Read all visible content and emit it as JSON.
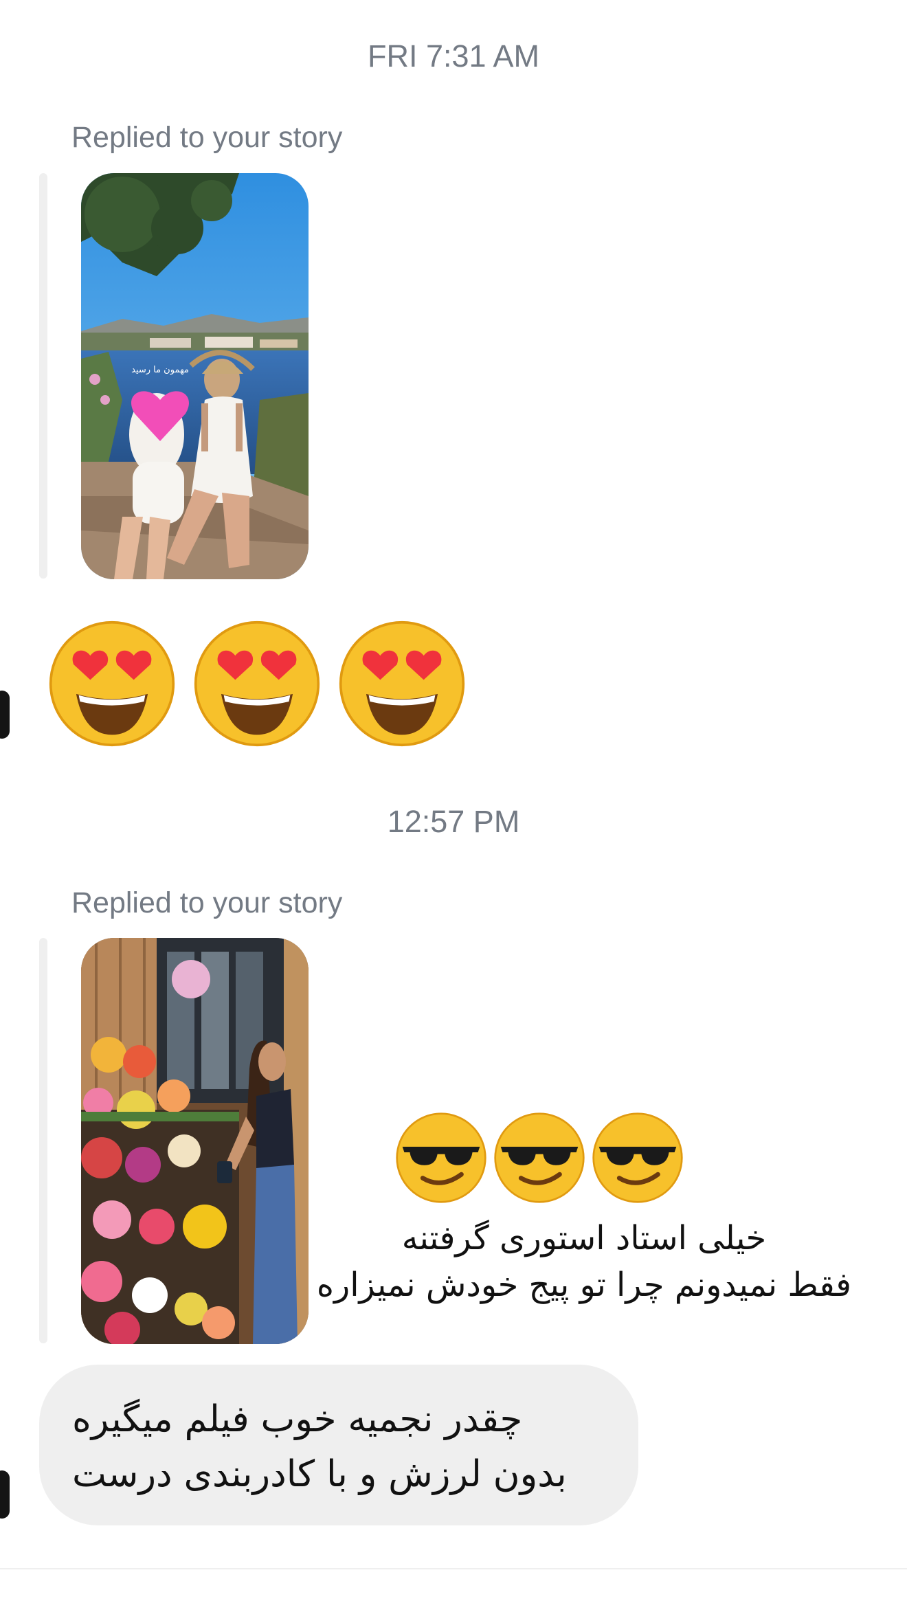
{
  "thread": {
    "timestamp_1": "FRI 7:31 AM",
    "timestamp_2": "12:57 PM",
    "story_reply_1": {
      "label": "Replied to your story",
      "sticker_text": "مهمون ما رسید",
      "reply_text": "😍😍😍"
    },
    "story_reply_2": {
      "label": "Replied to your story",
      "caption_line_1": "خیلی استاد استوری گرفتنه",
      "caption_line_2": "فقط نمیدونم چرا تو پیج خودش نمیزاره",
      "emoji_reply": "😎😎😎"
    },
    "message_1": {
      "line_1": "چقدر نجمیه خوب فیلم میگیره",
      "line_2": "بدون لرزش و با کادربندی درست"
    }
  },
  "colors": {
    "timestamp": "#737a84",
    "bubble_bg": "#efefef",
    "quote_bar": "#efefef",
    "emoji_face": "#f7c12b",
    "heart": "#f0323c"
  },
  "icons": {
    "heart_eyes": "heart-eyes-emoji",
    "sunglasses": "sunglasses-emoji"
  }
}
